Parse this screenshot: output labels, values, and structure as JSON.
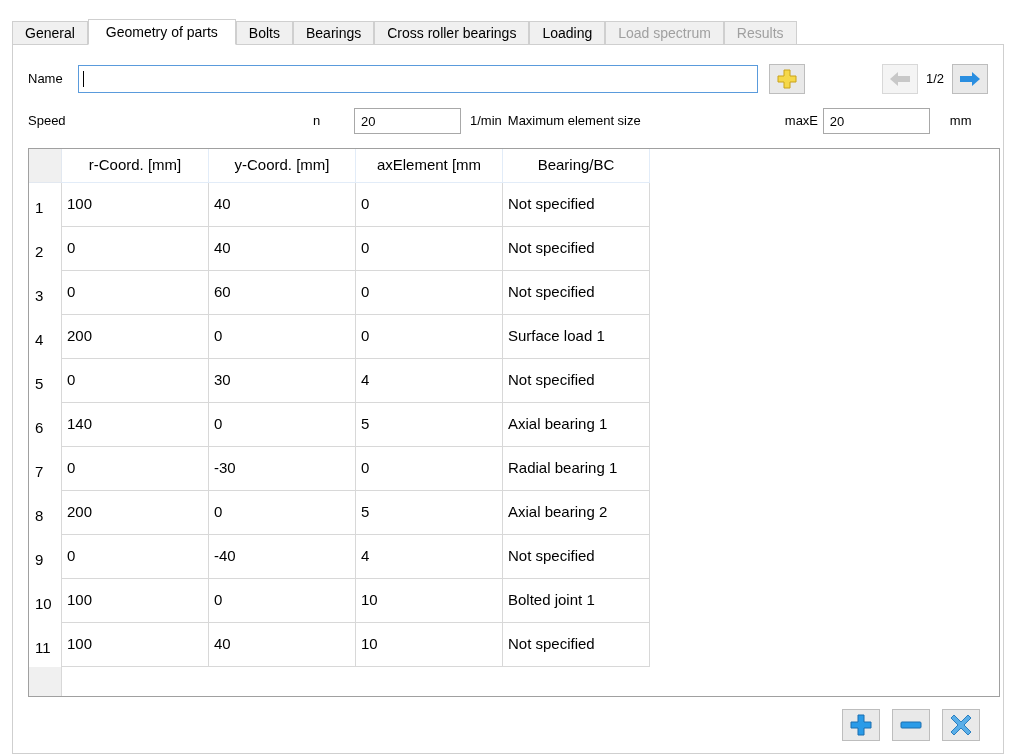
{
  "tabs": [
    {
      "label": "General",
      "selected": false,
      "disabled": false
    },
    {
      "label": "Geometry of parts",
      "selected": true,
      "disabled": false
    },
    {
      "label": "Bolts",
      "selected": false,
      "disabled": false
    },
    {
      "label": "Bearings",
      "selected": false,
      "disabled": false
    },
    {
      "label": "Cross roller bearings",
      "selected": false,
      "disabled": false
    },
    {
      "label": "Loading",
      "selected": false,
      "disabled": false
    },
    {
      "label": "Load spectrum",
      "selected": false,
      "disabled": true
    },
    {
      "label": "Results",
      "selected": false,
      "disabled": true
    }
  ],
  "name_field": {
    "label": "Name"
  },
  "pager": {
    "page": "1/2",
    "prev_disabled": true,
    "next_disabled": false
  },
  "speed": {
    "label": "Speed",
    "symbol": "n",
    "value": "20",
    "unit": "1/min"
  },
  "max_element": {
    "label": "Maximum element size",
    "symbol": "maxE",
    "value": "20",
    "unit": "mm"
  },
  "table": {
    "columns": [
      "r-Coord. [mm]",
      "y-Coord. [mm]",
      "axElement [mm",
      "Bearing/BC"
    ],
    "rows": [
      {
        "number": "1",
        "cells": [
          "100",
          "40",
          "0",
          "Not specified"
        ]
      },
      {
        "number": "2",
        "cells": [
          "0",
          "40",
          "0",
          "Not specified"
        ]
      },
      {
        "number": "3",
        "cells": [
          "0",
          "60",
          "0",
          "Not specified"
        ]
      },
      {
        "number": "4",
        "cells": [
          "200",
          "0",
          "0",
          "Surface load 1"
        ]
      },
      {
        "number": "5",
        "cells": [
          "0",
          "30",
          "4",
          "Not specified"
        ]
      },
      {
        "number": "6",
        "cells": [
          "140",
          "0",
          "5",
          "Axial bearing 1"
        ]
      },
      {
        "number": "7",
        "cells": [
          "0",
          "-30",
          "0",
          "Radial bearing 1"
        ]
      },
      {
        "number": "8",
        "cells": [
          "200",
          "0",
          "5",
          "Axial bearing 2"
        ]
      },
      {
        "number": "9",
        "cells": [
          "0",
          "-40",
          "4",
          "Not specified"
        ]
      },
      {
        "number": "10",
        "cells": [
          "100",
          "0",
          "10",
          "Bolted joint 1"
        ]
      },
      {
        "number": "11",
        "cells": [
          "100",
          "40",
          "10",
          "Not specified"
        ]
      }
    ]
  },
  "row_buttons": [
    {
      "kind": "add"
    },
    {
      "kind": "remove"
    },
    {
      "kind": "delete"
    }
  ]
}
